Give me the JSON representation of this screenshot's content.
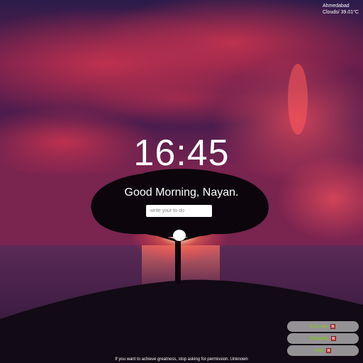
{
  "weather": {
    "city": "Ahmedabad",
    "condition": "Clouds/ 39.01°C"
  },
  "clock": {
    "time": "16:45"
  },
  "greeting": {
    "text": "Good Morning, Nayan."
  },
  "todo_input": {
    "placeholder": "write your to do"
  },
  "todos": [
    {
      "label": "Let's see",
      "remove_icon": "close-icon"
    },
    {
      "label": "Shopping",
      "remove_icon": "close-icon"
    },
    {
      "label": "Help",
      "remove_icon": "close-icon"
    }
  ],
  "quote": {
    "text": "If you want to achieve greatness, stop asking for permission. Unknown"
  },
  "colors": {
    "todo_text": "#7fd400",
    "remove_button": "#d9534f",
    "text": "#ffffff"
  }
}
